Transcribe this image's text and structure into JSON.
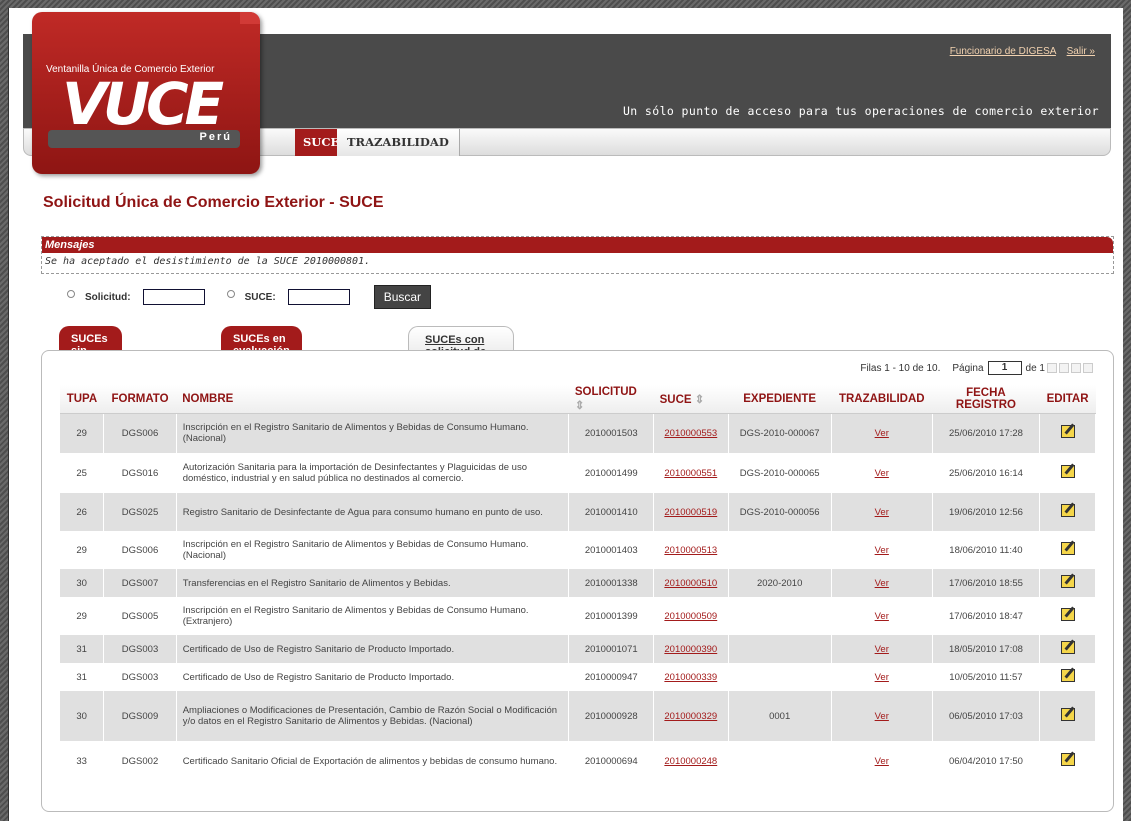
{
  "header": {
    "logo_small": "Ventanilla Única de Comercio Exterior",
    "logo_big": "VUCE",
    "logo_country": "Perú",
    "user_link": "Funcionario de DIGESA",
    "logout_link": "Salir »",
    "tagline": "Un sólo punto de acceso para tus operaciones de comercio exterior"
  },
  "nav": {
    "items": [
      {
        "label": "SUCE"
      },
      {
        "label": "TRAZABILIDAD"
      }
    ]
  },
  "page_title": "Solicitud Única de Comercio Exterior - SUCE",
  "messages": {
    "title": "Mensajes",
    "text": "Se ha aceptado el desistimiento de la SUCE 2010000801."
  },
  "search": {
    "solicitud_label": "Solicitud:",
    "suce_label": "SUCE:",
    "button": "Buscar"
  },
  "tabs": [
    {
      "label": "SUCEs sin evaluar"
    },
    {
      "label": "SUCEs en evaluación"
    },
    {
      "label": "SUCEs con solicitud de Desistimiento"
    }
  ],
  "pager": {
    "rows": "Filas 1 - 10 de 10.",
    "page_label": "Página",
    "page": "1",
    "of": "de 1"
  },
  "table": {
    "headers": [
      "TUPA",
      "FORMATO",
      "NOMBRE",
      "SOLICITUD",
      "SUCE",
      "EXPEDIENTE",
      "TRAZABILIDAD",
      "FECHA REGISTRO",
      "EDITAR"
    ],
    "sort_mark": "⇕",
    "rows": [
      {
        "tupa": "29",
        "formato": "DGS006",
        "nombre": "Inscripción en el Registro Sanitario de Alimentos y Bebidas de Consumo Humano. (Nacional)",
        "solicitud": "2010001503",
        "suce": "2010000553",
        "expediente": "DGS-2010-000067",
        "traz": "Ver",
        "fecha": "25/06/2010 17:28"
      },
      {
        "tupa": "25",
        "formato": "DGS016",
        "nombre": "Autorización Sanitaria para la importación de Desinfectantes y Plaguicidas de uso doméstico, industrial y en salud pública no destinados al comercio.",
        "solicitud": "2010001499",
        "suce": "2010000551",
        "expediente": "DGS-2010-000065",
        "traz": "Ver",
        "fecha": "25/06/2010 16:14"
      },
      {
        "tupa": "26",
        "formato": "DGS025",
        "nombre": "Registro Sanitario de Desinfectante de Agua para consumo humano en punto de uso.",
        "solicitud": "2010001410",
        "suce": "2010000519",
        "expediente": "DGS-2010-000056",
        "traz": "Ver",
        "fecha": "19/06/2010 12:56"
      },
      {
        "tupa": "29",
        "formato": "DGS006",
        "nombre": "Inscripción en el Registro Sanitario de Alimentos y Bebidas de Consumo Humano. (Nacional)",
        "solicitud": "2010001403",
        "suce": "2010000513",
        "expediente": "",
        "traz": "Ver",
        "fecha": "18/06/2010 11:40"
      },
      {
        "tupa": "30",
        "formato": "DGS007",
        "nombre": "Transferencias en el Registro Sanitario de Alimentos y Bebidas.",
        "solicitud": "2010001338",
        "suce": "2010000510",
        "expediente": "2020-2010",
        "traz": "Ver",
        "fecha": "17/06/2010 18:55"
      },
      {
        "tupa": "29",
        "formato": "DGS005",
        "nombre": "Inscripción en el Registro Sanitario de Alimentos y Bebidas de Consumo Humano. (Extranjero)",
        "solicitud": "2010001399",
        "suce": "2010000509",
        "expediente": "",
        "traz": "Ver",
        "fecha": "17/06/2010 18:47"
      },
      {
        "tupa": "31",
        "formato": "DGS003",
        "nombre": "Certificado de Uso de Registro Sanitario de Producto Importado.",
        "solicitud": "2010001071",
        "suce": "2010000390",
        "expediente": "",
        "traz": "Ver",
        "fecha": "18/05/2010 17:08"
      },
      {
        "tupa": "31",
        "formato": "DGS003",
        "nombre": "Certificado de Uso de Registro Sanitario de Producto Importado.",
        "solicitud": "2010000947",
        "suce": "2010000339",
        "expediente": "",
        "traz": "Ver",
        "fecha": "10/05/2010 11:57"
      },
      {
        "tupa": "30",
        "formato": "DGS009",
        "nombre": "Ampliaciones o Modificaciones de Presentación, Cambio de Razón Social o Modificación y/o datos en el Registro Sanitario de Alimentos y Bebidas. (Nacional)",
        "solicitud": "2010000928",
        "suce": "2010000329",
        "expediente": "0001",
        "traz": "Ver",
        "fecha": "06/05/2010 17:03"
      },
      {
        "tupa": "33",
        "formato": "DGS002",
        "nombre": "Certificado Sanitario Oficial de Exportación de alimentos y bebidas de consumo humano.",
        "solicitud": "2010000694",
        "suce": "2010000248",
        "expediente": "",
        "traz": "Ver",
        "fecha": "06/04/2010 17:50"
      }
    ]
  }
}
